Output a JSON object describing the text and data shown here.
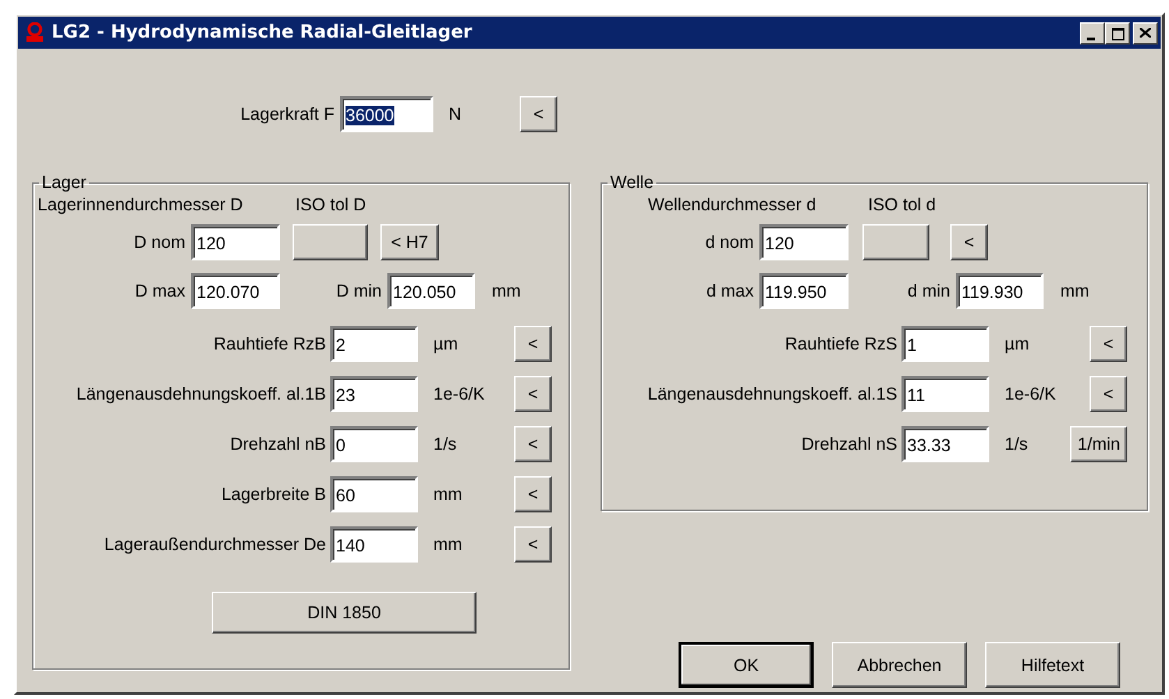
{
  "window": {
    "title": "LG2 - Hydrodynamische Radial-Gleitlager"
  },
  "load": {
    "label": "Lagerkraft F",
    "value": "36000",
    "selected": true,
    "unit": "N",
    "button": "<"
  },
  "groups": [
    {
      "kind": "bearing",
      "title": "Lager",
      "diameter": {
        "heading": "Lagerinnendurchmesser D",
        "tol_heading": "ISO tol D",
        "nom_label": "D nom",
        "nom_value": "120",
        "tol_button": "< H7",
        "max_label": "D max",
        "max_value": "120.070",
        "min_label": "D min",
        "min_value": "120.050",
        "unit": "mm"
      },
      "params": [
        {
          "label": "Rauhtiefe RzB",
          "value": "2",
          "unit": "µm",
          "button": "<"
        },
        {
          "label": "Längenausdehnungskoeff. al.1B",
          "value": "23",
          "unit": "1e-6/K",
          "button": "<"
        },
        {
          "label": "Drehzahl nB",
          "value": "0",
          "unit": "1/s",
          "button": "<"
        },
        {
          "label": "Lagerbreite B",
          "value": "60",
          "unit": "mm",
          "button": "<"
        },
        {
          "label": "Lageraußendurchmesser De",
          "value": "140",
          "unit": "mm",
          "button": "<"
        }
      ],
      "footer_button": "DIN 1850"
    },
    {
      "kind": "shaft",
      "title": "Welle",
      "diameter": {
        "heading": "Wellendurchmesser d",
        "tol_heading": "ISO tol d",
        "nom_label": "d nom",
        "nom_value": "120",
        "tol_button": "<",
        "max_label": "d max",
        "max_value": "119.950",
        "min_label": "d min",
        "min_value": "119.930",
        "unit": "mm"
      },
      "params": [
        {
          "label": "Rauhtiefe RzS",
          "value": "1",
          "unit": "µm",
          "button": "<"
        },
        {
          "label": "Längenausdehnungskoeff. al.1S",
          "value": "11",
          "unit": "1e-6/K",
          "button": "<"
        },
        {
          "label": "Drehzahl nS",
          "value": "33.33",
          "unit": "1/s",
          "button": "1/min"
        }
      ]
    }
  ],
  "buttons": [
    {
      "label": "OK",
      "default": true
    },
    {
      "label": "Abbrechen",
      "default": false
    },
    {
      "label": "Hilfetext",
      "default": false
    }
  ]
}
